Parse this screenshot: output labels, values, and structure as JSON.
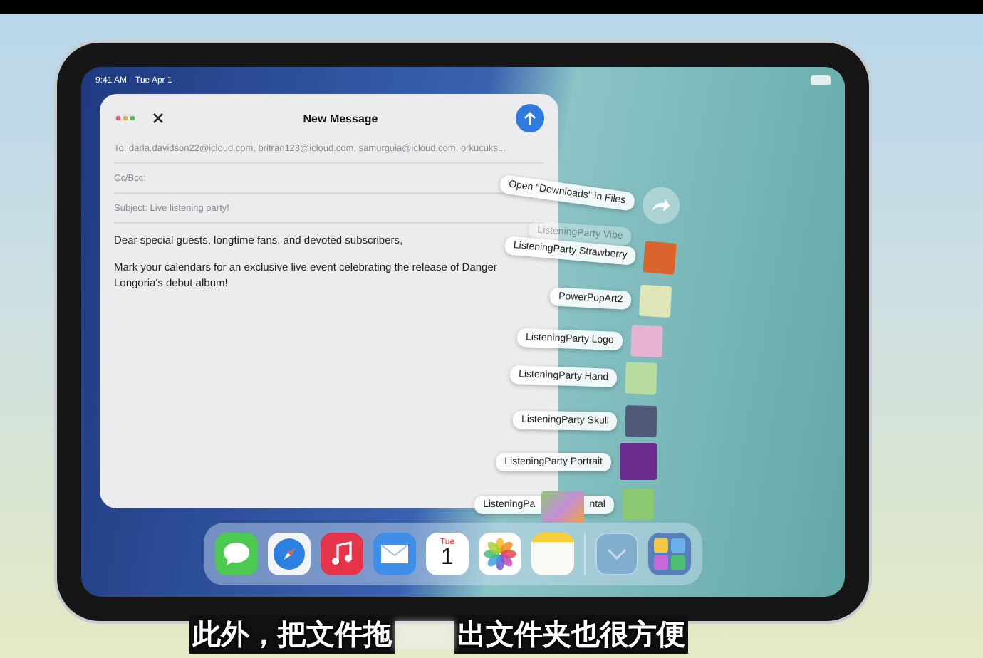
{
  "status_bar": {
    "time": "9:41 AM",
    "date": "Tue Apr 1"
  },
  "compose": {
    "title": "New Message",
    "to": "To: darla.davidson22@icloud.com, britran123@icloud.com, samurguia@icloud.com, orkucuks...",
    "cc": "Cc/Bcc:",
    "subject": "Subject: Live listening party!",
    "body": [
      "Dear special guests, longtime fans, and devoted subscribers,",
      "Mark your calendars for an exclusive live event celebrating the release of Danger Longoria's debut album!"
    ]
  },
  "downloads_stack": [
    {
      "kind": "open",
      "label": "Open \"Downloads\" in Files"
    },
    {
      "kind": "faded",
      "label": "ListeningParty Vibe"
    },
    {
      "kind": "file",
      "label": "ListeningParty Strawberry",
      "color": "#d9642c"
    },
    {
      "kind": "file",
      "label": "PowerPopArt2",
      "color": "#dfe6b8"
    },
    {
      "kind": "file",
      "label": "ListeningParty Logo",
      "color": "#e6b4d2"
    },
    {
      "kind": "file",
      "label": "ListeningParty Hand",
      "color": "#b8dca0"
    },
    {
      "kind": "file",
      "label": "ListeningParty Skull",
      "color": "#4e5a78"
    },
    {
      "kind": "file",
      "label": "ListeningParty Portrait",
      "color": "#6a2c8c"
    },
    {
      "kind": "covered",
      "label": "ListeningPa",
      "label_end": "ntal",
      "color": "#8cc870"
    }
  ],
  "dock": [
    {
      "kind": "messages"
    },
    {
      "kind": "safari"
    },
    {
      "kind": "music"
    },
    {
      "kind": "mail"
    },
    {
      "kind": "calendar",
      "day": "Tue",
      "date": "1"
    },
    {
      "kind": "photos"
    },
    {
      "kind": "notes"
    },
    {
      "kind": "divider"
    },
    {
      "kind": "downloads"
    },
    {
      "kind": "library"
    }
  ],
  "subtitle": {
    "start": "此外，把文件拖",
    "end": "出文件夹也很方便"
  }
}
